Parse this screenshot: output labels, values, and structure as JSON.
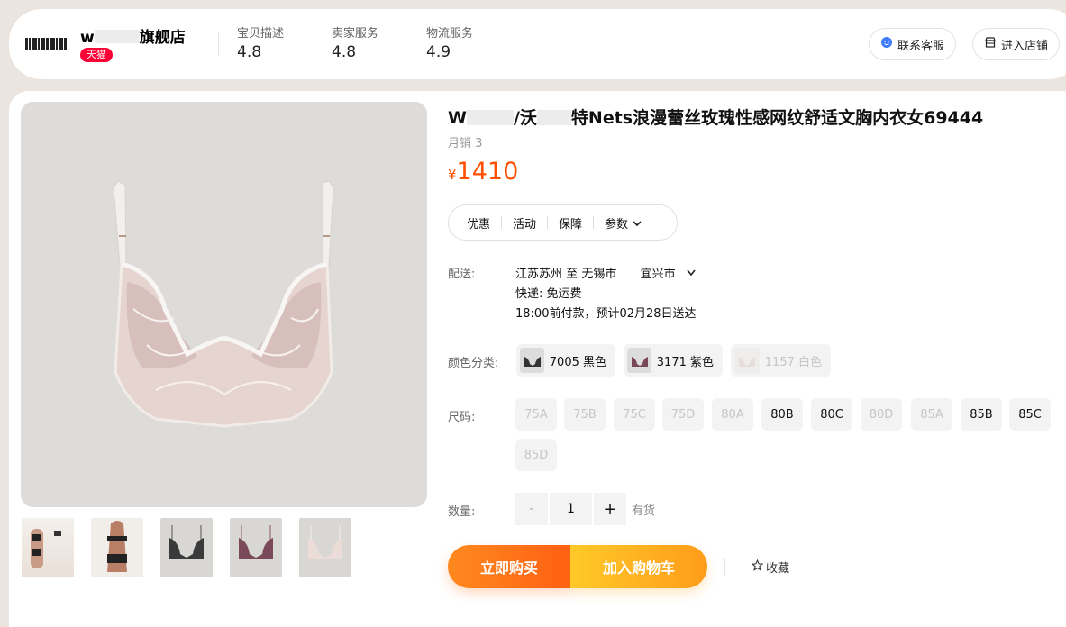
{
  "shop": {
    "name_prefix": "w",
    "name_suffix": "旗舰店",
    "badge": "天猫",
    "ratings": [
      {
        "label": "宝贝描述",
        "value": "4.8"
      },
      {
        "label": "卖家服务",
        "value": "4.8"
      },
      {
        "label": "物流服务",
        "value": "4.9"
      }
    ],
    "contact_button": "联系客服",
    "enter_store_button": "进入店铺"
  },
  "product": {
    "title_part1": "W",
    "title_part2": "/沃",
    "title_part3": "特Nets浪漫蕾丝玫瑰性感网纹舒适文胸内衣女69444",
    "monthly_sales": "月销 3",
    "currency": "¥",
    "price": "1410"
  },
  "tabs": [
    "优惠",
    "活动",
    "保障",
    "参数"
  ],
  "shipping": {
    "label": "配送:",
    "origin": "江苏苏州",
    "to": "至",
    "destination": "无锡市",
    "district": "宜兴市",
    "delivery": "快递: 免运费",
    "eta": "18:00前付款，预计02月28日送达"
  },
  "color": {
    "label": "颜色分类:",
    "options": [
      {
        "label": "7005 黑色",
        "available": true
      },
      {
        "label": "3171 紫色",
        "available": true
      },
      {
        "label": "1157 白色",
        "available": false
      }
    ]
  },
  "size": {
    "label": "尺码:",
    "options": [
      {
        "label": "75A",
        "available": false
      },
      {
        "label": "75B",
        "available": false
      },
      {
        "label": "75C",
        "available": false
      },
      {
        "label": "75D",
        "available": false
      },
      {
        "label": "80A",
        "available": false
      },
      {
        "label": "80B",
        "available": true
      },
      {
        "label": "80C",
        "available": true
      },
      {
        "label": "80D",
        "available": false
      },
      {
        "label": "85A",
        "available": false
      },
      {
        "label": "85B",
        "available": true
      },
      {
        "label": "85C",
        "available": true
      },
      {
        "label": "85D",
        "available": false
      }
    ]
  },
  "quantity": {
    "label": "数量:",
    "minus": "-",
    "value": "1",
    "plus": "+",
    "stock": "有货"
  },
  "actions": {
    "buy_now": "立即购买",
    "add_to_cart": "加入购物车",
    "favorite": "收藏"
  },
  "colors": {
    "accent": "#ff5000",
    "tmall_red": "#ff0036",
    "buy_gradient": [
      "#ff8a1f",
      "#ff5f13"
    ],
    "cart_gradient": [
      "#ffc928",
      "#ff9c1a"
    ]
  },
  "icons": [
    "shop-logo",
    "smile-chat-icon",
    "store-icon",
    "chevron-down-icon",
    "star-icon"
  ]
}
